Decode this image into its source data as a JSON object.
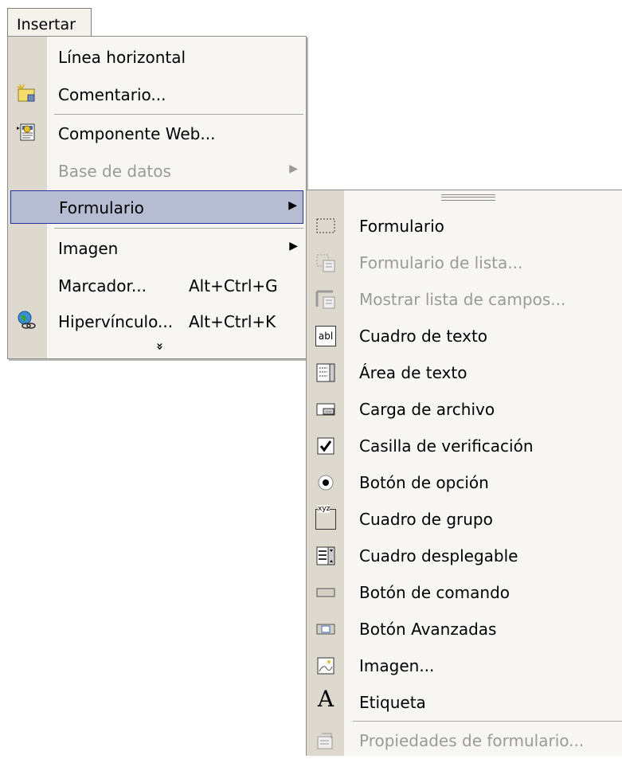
{
  "menubar": {
    "label": "Insertar"
  },
  "menu": {
    "items": [
      {
        "label": "Línea horizontal",
        "shortcut": "",
        "has_submenu": false,
        "disabled": false,
        "icon": ""
      },
      {
        "label": "Comentario...",
        "shortcut": "",
        "has_submenu": false,
        "disabled": false,
        "icon": "comment-icon"
      },
      {
        "label": "Componente Web...",
        "shortcut": "",
        "has_submenu": false,
        "disabled": false,
        "icon": "web-component-icon"
      },
      {
        "label": "Base de datos",
        "shortcut": "",
        "has_submenu": true,
        "disabled": true,
        "icon": ""
      },
      {
        "label": "Formulario",
        "shortcut": "",
        "has_submenu": true,
        "disabled": false,
        "icon": "",
        "highlighted": true
      },
      {
        "label": "Imagen",
        "shortcut": "",
        "has_submenu": true,
        "disabled": false,
        "icon": ""
      },
      {
        "label": "Marcador...",
        "shortcut": "Alt+Ctrl+G",
        "has_submenu": false,
        "disabled": false,
        "icon": ""
      },
      {
        "label": "Hipervínculo...",
        "shortcut": "Alt+Ctrl+K",
        "has_submenu": false,
        "disabled": false,
        "icon": "hyperlink-icon"
      }
    ],
    "more_glyph": "»"
  },
  "submenu": {
    "items": [
      {
        "label": "Formulario",
        "disabled": false,
        "icon": "form-icon"
      },
      {
        "label": "Formulario de lista...",
        "disabled": true,
        "icon": "list-form-icon"
      },
      {
        "label": "Mostrar lista de campos...",
        "disabled": true,
        "icon": "field-list-icon"
      },
      {
        "label": "Cuadro de texto",
        "disabled": false,
        "icon": "textbox-icon"
      },
      {
        "label": "Área de texto",
        "disabled": false,
        "icon": "textarea-icon"
      },
      {
        "label": "Carga de archivo",
        "disabled": false,
        "icon": "file-upload-icon"
      },
      {
        "label": "Casilla de verificación",
        "disabled": false,
        "icon": "checkbox-icon"
      },
      {
        "label": "Botón de opción",
        "disabled": false,
        "icon": "radio-icon"
      },
      {
        "label": "Cuadro de grupo",
        "disabled": false,
        "icon": "group-box-icon"
      },
      {
        "label": "Cuadro desplegable",
        "disabled": false,
        "icon": "dropdown-icon"
      },
      {
        "label": "Botón de comando",
        "disabled": false,
        "icon": "command-button-icon"
      },
      {
        "label": "Botón Avanzadas",
        "disabled": false,
        "icon": "advanced-button-icon"
      },
      {
        "label": "Imagen...",
        "disabled": false,
        "icon": "image-icon"
      },
      {
        "label": "Etiqueta",
        "disabled": false,
        "icon": "label-icon"
      },
      {
        "label": "Propiedades de formulario...",
        "disabled": true,
        "icon": "form-properties-icon"
      }
    ]
  },
  "icon_text": {
    "textbox": "abl",
    "group": "xyz",
    "label": "A"
  }
}
